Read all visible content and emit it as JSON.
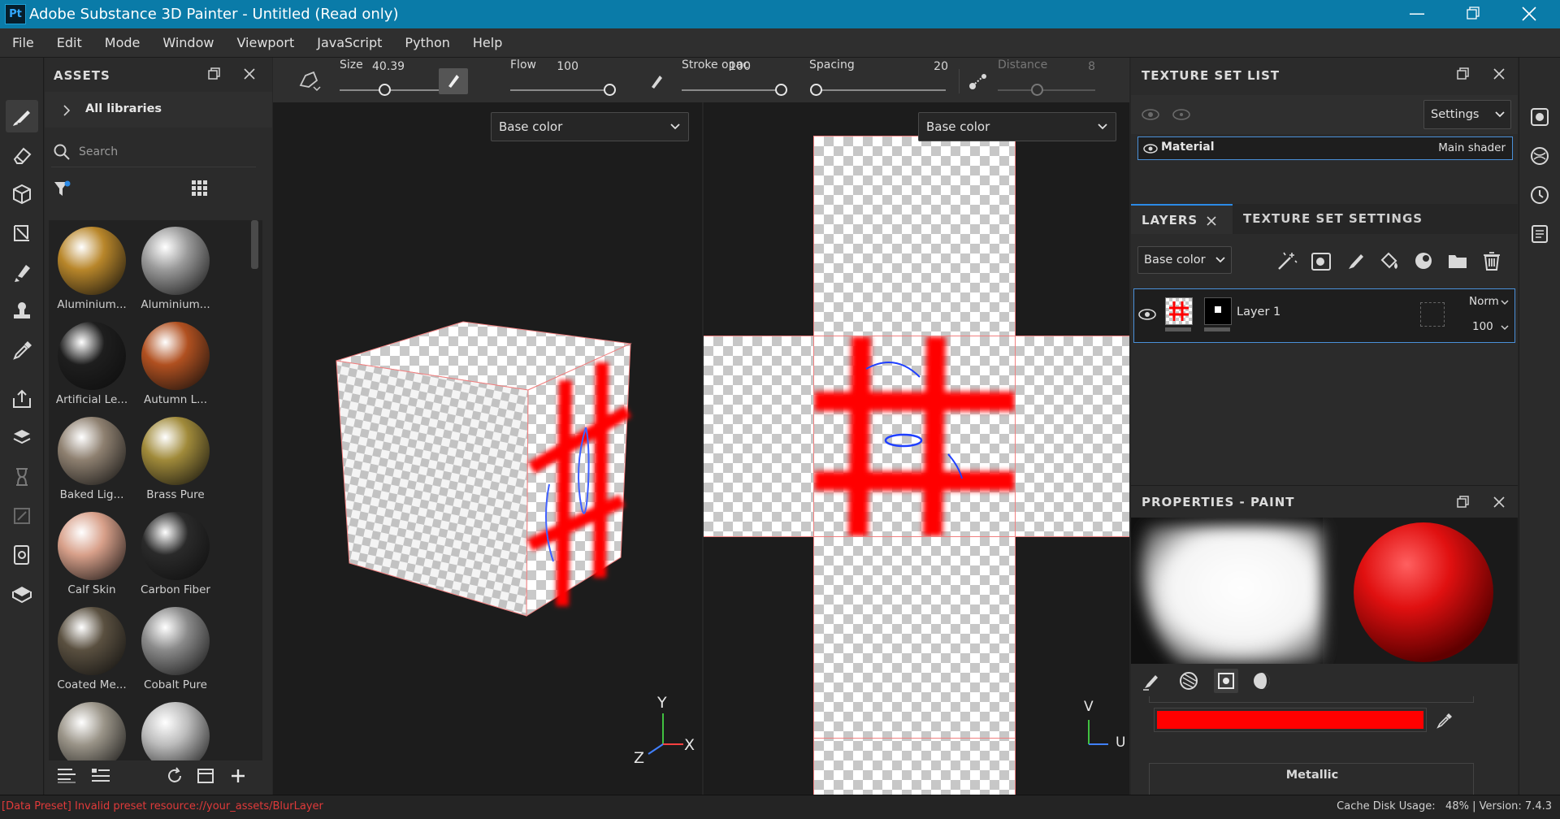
{
  "window": {
    "app_icon": "Pt",
    "title": "Adobe Substance 3D Painter - Untitled (Read only)",
    "controls": [
      "minimize-icon",
      "restore-icon",
      "close-icon"
    ]
  },
  "menu": [
    "File",
    "Edit",
    "Mode",
    "Window",
    "Viewport",
    "JavaScript",
    "Python",
    "Help"
  ],
  "assets": {
    "title": "ASSETS",
    "library": "All libraries",
    "search_placeholder": "Search",
    "items": [
      {
        "label": "Aluminium...",
        "color": "#b8862a"
      },
      {
        "label": "Aluminium...",
        "color": "#9a9a9a"
      },
      {
        "label": "Artificial Le...",
        "color": "#1e1e1e"
      },
      {
        "label": "Autumn L...",
        "color": "#b05020"
      },
      {
        "label": "Baked Lig...",
        "color": "#8e8070"
      },
      {
        "label": "Brass Pure",
        "color": "#a08a3a"
      },
      {
        "label": "Calf Skin",
        "color": "#d8a08a"
      },
      {
        "label": "Carbon Fiber",
        "color": "#2a2a2a"
      },
      {
        "label": "Coated Me...",
        "color": "#5a5040"
      },
      {
        "label": "Cobalt Pure",
        "color": "#8a8a8a"
      },
      {
        "label": "",
        "color": "#9a9488"
      },
      {
        "label": "",
        "color": "#bcbcbc"
      }
    ]
  },
  "brush": {
    "size_label": "Size",
    "size_value": "40.39",
    "size": 0.45,
    "flow_label": "Flow",
    "flow_value": "100",
    "flow": 1.0,
    "opacity_label": "Stroke opac",
    "opacity_value": "100",
    "opacity": 1.0,
    "spacing_label": "Spacing",
    "spacing_value": "20",
    "spacing": 0.0,
    "distance_label": "Distance",
    "distance_value": "8",
    "distance": 0.4
  },
  "viewport3d": {
    "channel": "Base color",
    "axes": {
      "x": "X",
      "y": "Y",
      "z": "Z"
    }
  },
  "viewport2d": {
    "channel": "Base color",
    "axes": {
      "u": "U",
      "v": "V"
    }
  },
  "texture_set_list": {
    "title": "TEXTURE SET LIST",
    "settings_label": "Settings",
    "material_name": "Material",
    "shader": "Main shader"
  },
  "layers": {
    "tab_layers": "LAYERS",
    "tab_settings": "TEXTURE SET SETTINGS",
    "channel": "Base color",
    "layer_name": "Layer 1",
    "blend_mode": "Norm",
    "opacity": "100"
  },
  "properties": {
    "title": "PROPERTIES - PAINT",
    "base_color": "#ff0000",
    "metallic_label": "Metallic"
  },
  "status": {
    "message": "[Data Preset] Invalid preset resource://your_assets/BlurLayer",
    "info": "Cache Disk Usage:   48% | Version: 7.4.3"
  }
}
